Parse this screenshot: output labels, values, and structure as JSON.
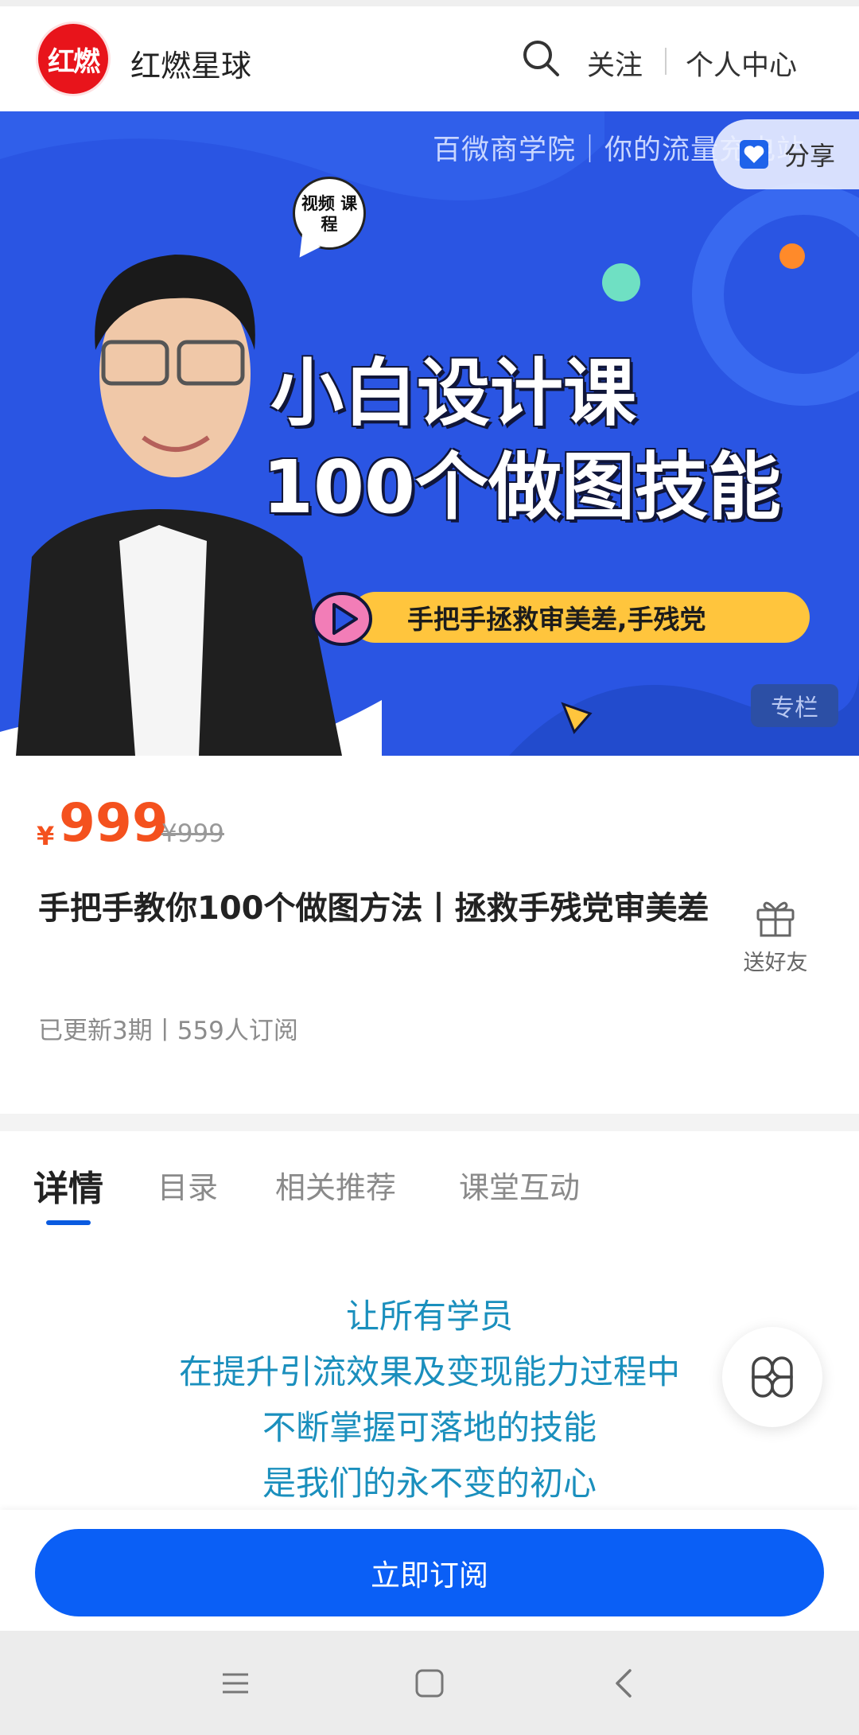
{
  "header": {
    "logo_text": "红燃",
    "app_name": "红燃星球",
    "follow_label": "关注",
    "profile_label": "个人中心"
  },
  "banner": {
    "subtitle": "百微商学院｜你的流量充电站",
    "share_label": "分享",
    "bubble_text": "视频 课程",
    "title_line1": "小白设计课",
    "title_line2": "100个做图技能",
    "pill_text": "手把手拯救审美差,手残党",
    "tag": "专栏"
  },
  "product": {
    "currency": "¥",
    "price": "999",
    "original_price": "¥999",
    "title": "手把手教你100个做图方法丨拯救手残党审美差",
    "gift_label": "送好友",
    "meta": "已更新3期丨559人订阅"
  },
  "tabs": [
    {
      "label": "详情"
    },
    {
      "label": "目录"
    },
    {
      "label": "相关推荐"
    },
    {
      "label": "课堂互动"
    }
  ],
  "detail": {
    "lines": [
      "让所有学员",
      "在提升引流效果及变现能力过程中",
      "不断掌握可落地的技能",
      "是我们的永不变的初心"
    ]
  },
  "bottom": {
    "subscribe_label": "立即订阅"
  },
  "colors": {
    "accent_blue": "#0a5ff6",
    "price_orange": "#f4511e",
    "banner_blue": "#2a55e3",
    "detail_text": "#1a8fbd"
  }
}
